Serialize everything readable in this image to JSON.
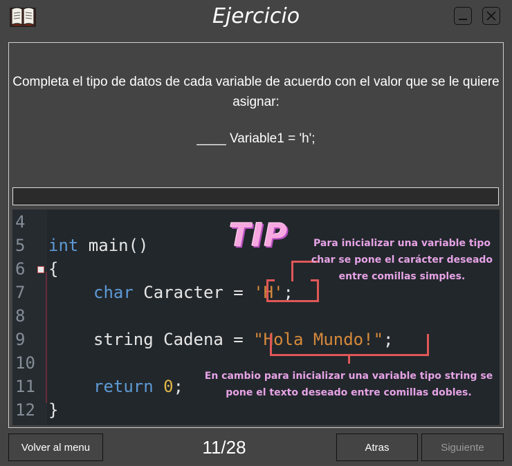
{
  "window": {
    "title": "Ejercicio",
    "icons": {
      "app": "book-icon",
      "minimize": "minimize-icon",
      "close": "close-icon"
    }
  },
  "question": {
    "text": "Completa el tipo de datos de cada variable de acuerdo con el valor que se le quiere asignar:",
    "code_line": "____ Variable1 = 'h';"
  },
  "answer": {
    "value": "",
    "placeholder": ""
  },
  "code": {
    "tip_title": "TIP",
    "line_numbers": [
      "4",
      "5",
      "6",
      "7",
      "8",
      "9",
      "10",
      "11",
      "12"
    ],
    "lines": {
      "l5_kw": "int",
      "l5_rest": " main()",
      "l6": "{",
      "l7_kw": "char",
      "l7_mid": " Caracter = ",
      "l7_str": "'H'",
      "l7_end": ";",
      "l9_plain": "string Cadena = ",
      "l9_str": "\"Hola Mundo!\"",
      "l9_end": ";",
      "l11_kw": "return",
      "l11_num": "0",
      "l11_end": ";",
      "l12": "}"
    },
    "note_char": "Para inicializar una variable tipo char se pone el carácter deseado entre comillas simples.",
    "note_string": "En cambio para inicializar una variable tipo string se pone el texto deseado entre comillas dobles."
  },
  "footer": {
    "menu_label": "Volver al menu",
    "pager": "11/28",
    "back_label": "Atras",
    "next_label": "Siguiente"
  },
  "colors": {
    "background": "#444444",
    "code_bg": "#22272b",
    "bracket": "#e15757",
    "note_text": "#e6a3e6",
    "tip": "#f7a8e0"
  }
}
